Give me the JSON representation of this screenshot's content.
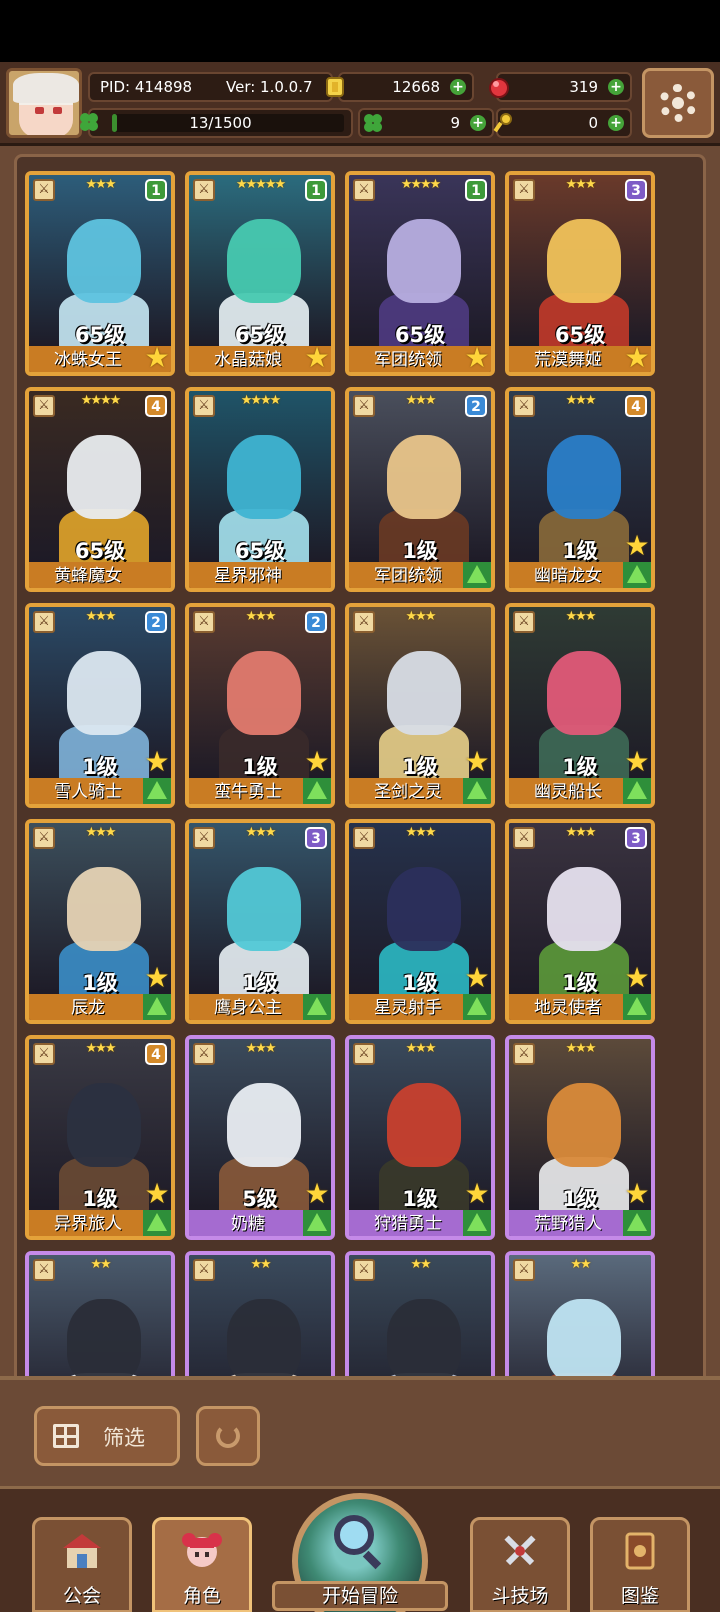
{
  "hud": {
    "pid": "PID: 414898",
    "version": "Ver: 1.0.0.7",
    "xp_text": "13/1500",
    "xp_fraction": 0.0087,
    "gold": "12668",
    "gems": "319",
    "clover": "9",
    "keys": "0"
  },
  "colors": {
    "frame_gold": "#e4a23a",
    "frame_purple": "#c58ae8",
    "plus_green": "#45a339",
    "star_yellow": "#ffd94a"
  },
  "cards": [
    {
      "name": "冰蛛女王",
      "level": "65级",
      "stars": "★★★",
      "badge": "1",
      "badge_color": "g",
      "hair": "#5ec3df",
      "outfit": "#c7e9f5",
      "bg": "#2d5d7a",
      "frame": "gold",
      "corner": "star"
    },
    {
      "name": "水晶菇娘",
      "level": "65级",
      "stars": "★★★★★",
      "badge": "1",
      "badge_color": "g",
      "hair": "#47c9b0",
      "outfit": "#e9f3f6",
      "bg": "#2b6c7e",
      "frame": "gold",
      "corner": "star"
    },
    {
      "name": "军团统领",
      "level": "65级",
      "stars": "★★★★",
      "badge": "1",
      "badge_color": "g",
      "hair": "#b7aee0",
      "outfit": "#4f3b82",
      "bg": "#3a3559",
      "frame": "gold",
      "corner": "star"
    },
    {
      "name": "荒漠舞姬",
      "level": "65级",
      "stars": "★★★",
      "badge": "3",
      "badge_color": "p",
      "hair": "#f0c25a",
      "outfit": "#c23a2a",
      "bg": "#6a3a2a",
      "frame": "gold",
      "corner": "star"
    },
    {
      "name": "黄蜂魔女",
      "level": "65级",
      "stars": "★★★★",
      "badge": "4",
      "badge_color": "o",
      "hair": "#e9ecef",
      "outfit": "#e2a52a",
      "bg": "#3a2a22",
      "frame": "gold",
      "corner": "none"
    },
    {
      "name": "星界邪神",
      "level": "65级",
      "stars": "★★★★",
      "badge": "",
      "badge_color": "",
      "hair": "#3fb4d2",
      "outfit": "#a6e3ef",
      "bg": "#1f5468",
      "frame": "gold",
      "corner": "none"
    },
    {
      "name": "军团统领",
      "level": "1级",
      "stars": "★★★",
      "badge": "2",
      "badge_color": "b",
      "hair": "#e9c58a",
      "outfit": "#6a3a24",
      "bg": "#4a4f5c",
      "frame": "gold",
      "corner": "up"
    },
    {
      "name": "幽暗龙女",
      "level": "1级",
      "stars": "★★★",
      "badge": "4",
      "badge_color": "o",
      "hair": "#2a7ec8",
      "outfit": "#8a6a3a",
      "bg": "#2d3c4e",
      "frame": "gold",
      "corner": "both"
    },
    {
      "name": "雪人骑士",
      "level": "1级",
      "stars": "★★★",
      "badge": "2",
      "badge_color": "b",
      "hair": "#dbe7f0",
      "outfit": "#7fb4da",
      "bg": "#2b4a66",
      "frame": "gold",
      "corner": "both"
    },
    {
      "name": "蛮牛勇士",
      "level": "1级",
      "stars": "★★★",
      "badge": "2",
      "badge_color": "b",
      "hair": "#e27a6e",
      "outfit": "#3a2a2a",
      "bg": "#5a3b30",
      "frame": "gold",
      "corner": "both"
    },
    {
      "name": "圣剑之灵",
      "level": "1级",
      "stars": "★★★",
      "badge": "",
      "badge_color": "",
      "hair": "#d8dde6",
      "outfit": "#e9d08a",
      "bg": "#6a5236",
      "frame": "gold",
      "corner": "both"
    },
    {
      "name": "幽灵船长",
      "level": "1级",
      "stars": "★★★",
      "badge": "",
      "badge_color": "",
      "hair": "#e05a78",
      "outfit": "#3e6a56",
      "bg": "#2f3b34",
      "frame": "gold",
      "corner": "both"
    },
    {
      "name": "辰龙",
      "level": "1级",
      "stars": "★★★",
      "badge": "",
      "badge_color": "",
      "hair": "#e6d3b4",
      "outfit": "#3b8ec8",
      "bg": "#3c4f5c",
      "frame": "gold",
      "corner": "both"
    },
    {
      "name": "鹰身公主",
      "level": "1级",
      "stars": "★★★",
      "badge": "3",
      "badge_color": "p",
      "hair": "#52c8d6",
      "outfit": "#e8f0f4",
      "bg": "#34556a",
      "frame": "gold",
      "corner": "up"
    },
    {
      "name": "星灵射手",
      "level": "1级",
      "stars": "★★★",
      "badge": "",
      "badge_color": "",
      "hair": "#2c2f5c",
      "outfit": "#2bb9c4",
      "bg": "#26324c",
      "frame": "gold",
      "corner": "both"
    },
    {
      "name": "地灵使者",
      "level": "1级",
      "stars": "★★★",
      "badge": "3",
      "badge_color": "p",
      "hair": "#e6e0ee",
      "outfit": "#5c9a3a",
      "bg": "#3a3340",
      "frame": "gold",
      "corner": "both"
    },
    {
      "name": "异界旅人",
      "level": "1级",
      "stars": "★★★",
      "badge": "4",
      "badge_color": "o",
      "hair": "#2b3040",
      "outfit": "#6a4a34",
      "bg": "#3a3a44",
      "frame": "gold",
      "corner": "both"
    },
    {
      "name": "奶糖",
      "level": "5级",
      "stars": "★★★",
      "badge": "",
      "badge_color": "",
      "hair": "#e9edf2",
      "outfit": "#8a5a3a",
      "bg": "#3b4b5c",
      "frame": "purple",
      "corner": "both"
    },
    {
      "name": "狩猎勇士",
      "level": "1级",
      "stars": "★★★",
      "badge": "",
      "badge_color": "",
      "hair": "#c8402e",
      "outfit": "#3a3a2a",
      "bg": "#3a4a5c",
      "frame": "purple",
      "corner": "both"
    },
    {
      "name": "荒野猎人",
      "level": "1级",
      "stars": "★★★",
      "badge": "",
      "badge_color": "",
      "hair": "#d98a3a",
      "outfit": "#ecedee",
      "bg": "#5c4a3a",
      "frame": "purple",
      "corner": "both"
    },
    {
      "name": "",
      "level": "",
      "stars": "★★",
      "badge": "",
      "badge_color": "",
      "hair": "#2a2d38",
      "outfit": "#f2f2f2",
      "bg": "#4a5a6c",
      "frame": "purple",
      "corner": "none"
    },
    {
      "name": "",
      "level": "",
      "stars": "★★",
      "badge": "",
      "badge_color": "",
      "hair": "#2a2d38",
      "outfit": "#e8d6c4",
      "bg": "#3a4a5c",
      "frame": "purple",
      "corner": "none"
    },
    {
      "name": "",
      "level": "",
      "stars": "★★",
      "badge": "",
      "badge_color": "",
      "hair": "#2a2d38",
      "outfit": "#c2c8d6",
      "bg": "#3a4a5a",
      "frame": "purple",
      "corner": "none"
    },
    {
      "name": "",
      "level": "",
      "stars": "★★",
      "badge": "",
      "badge_color": "",
      "hair": "#bfe4f2",
      "outfit": "#a84a30",
      "bg": "#5a6a7c",
      "frame": "purple",
      "corner": "none"
    }
  ],
  "toolbar": {
    "filter_label": "筛选"
  },
  "nav": {
    "guild": "公会",
    "roles": "角色",
    "adventure": "开始冒险",
    "arena": "斗技场",
    "codex": "图鉴"
  }
}
